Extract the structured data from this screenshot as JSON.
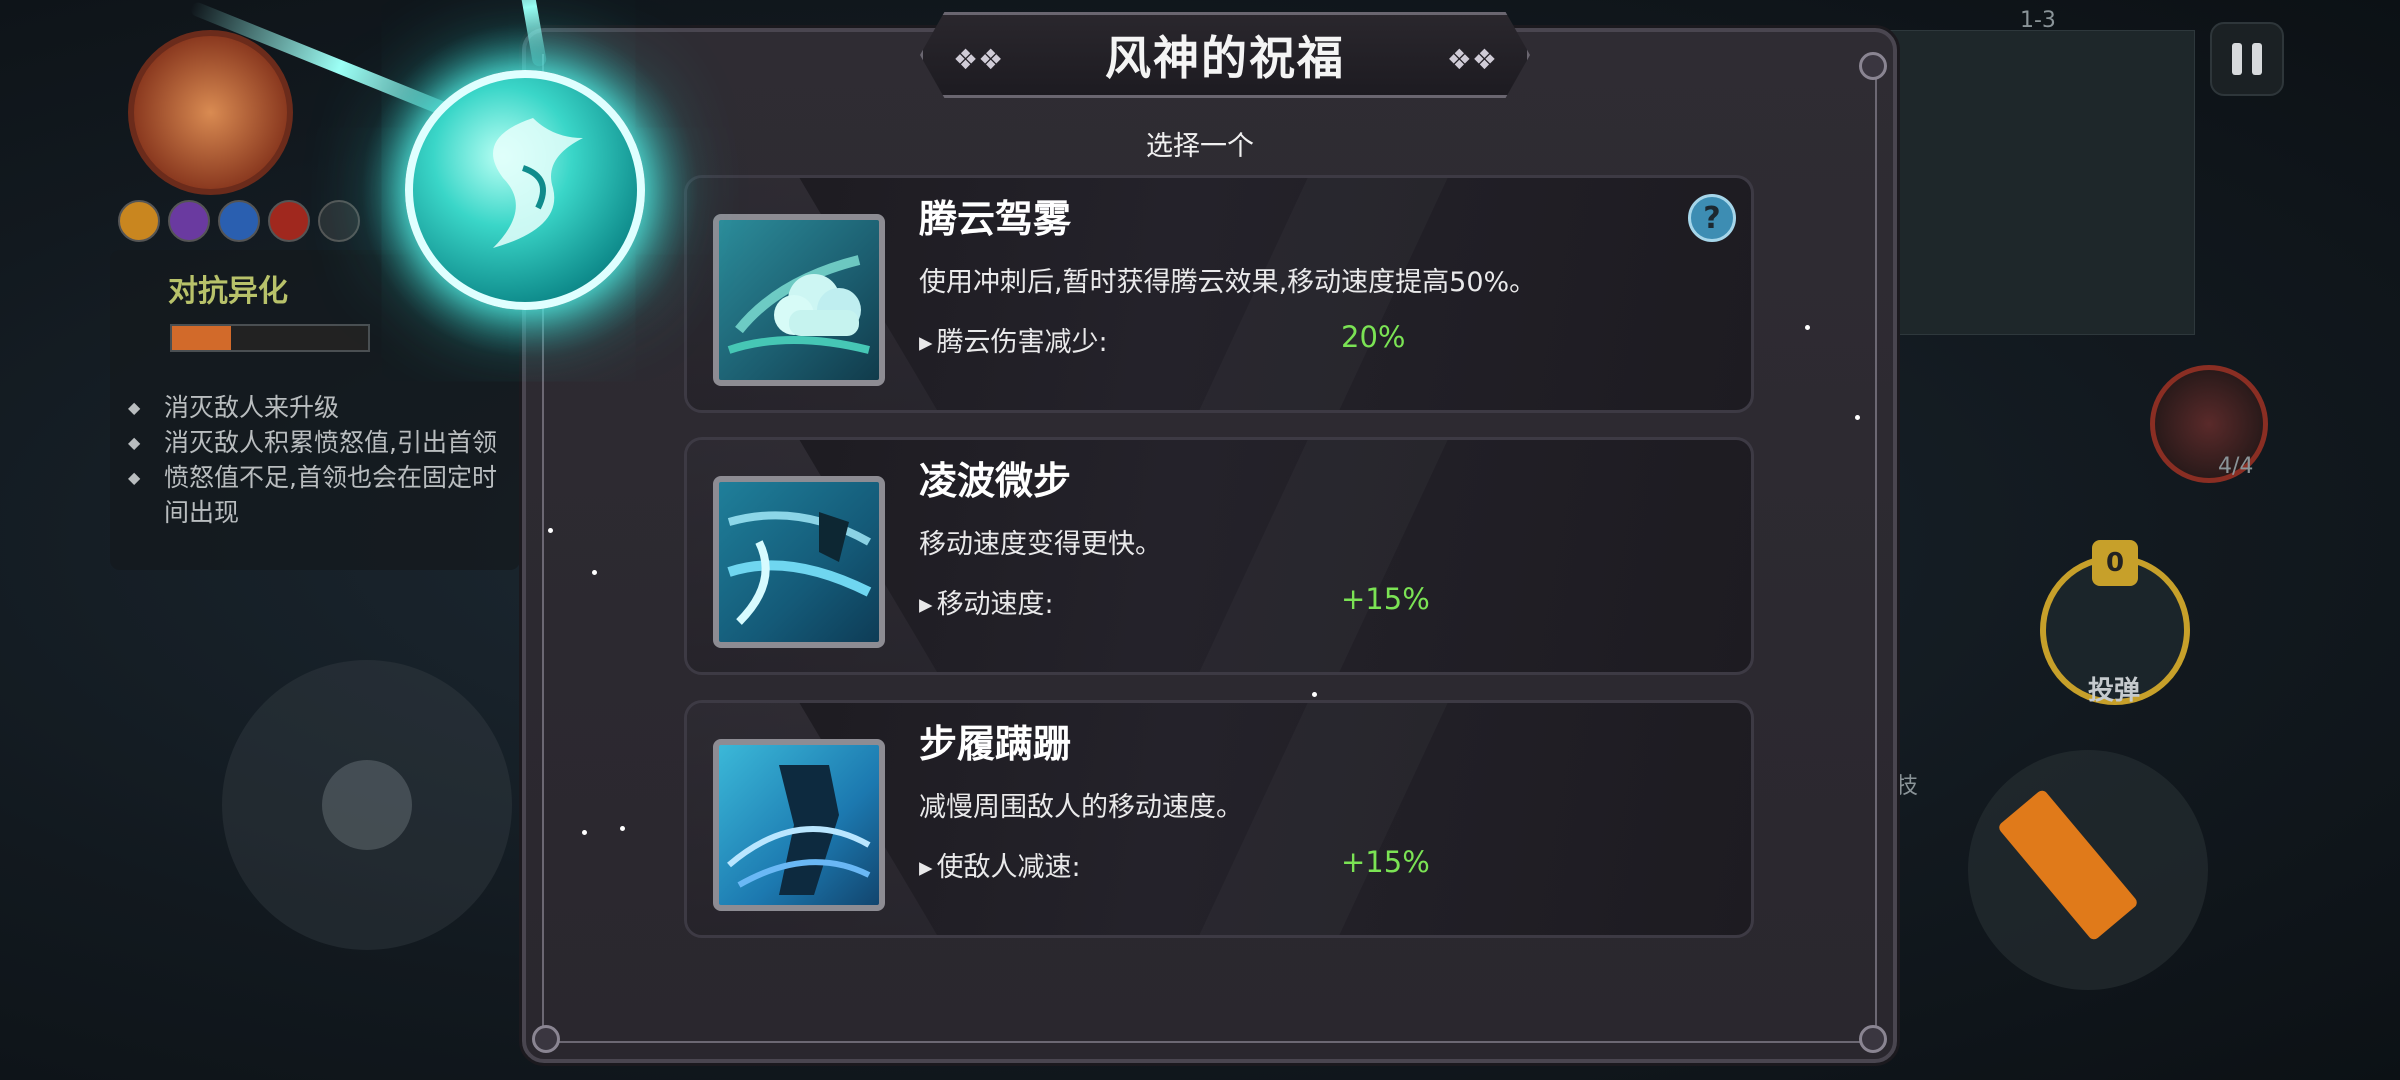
{
  "hud": {
    "level": "1-3",
    "left_panel": {
      "title": "对抗异化",
      "progress": 0.3,
      "bullets": [
        "消灭敌人来升级",
        "消灭敌人积累愤怒值,引出首领",
        "愤怒值不足,首领也会在固定时间出现"
      ]
    },
    "potion_count": "4/4",
    "bomb_count": "0",
    "bomb_label": "投弹",
    "skill_label": "技"
  },
  "modal": {
    "title": "风神的祝福",
    "subtitle": "选择一个",
    "cards": [
      {
        "title": "腾云驾雾",
        "description": "使用冲刺后,暂时获得腾云效果,移动速度提高50%。",
        "stat_label": "腾云伤害减少:",
        "stat_value": "20%",
        "icon": "cloud-icon",
        "has_help": true
      },
      {
        "title": "凌波微步",
        "description": "移动速度变得更快。",
        "stat_label": "移动速度:",
        "stat_value": "+15%",
        "icon": "wind-step-icon",
        "has_help": false
      },
      {
        "title": "步履蹒跚",
        "description": "减慢周围敌人的移动速度。",
        "stat_label": "使敌人减速:",
        "stat_value": "+15%",
        "icon": "slow-enemy-icon",
        "has_help": false
      }
    ],
    "help_glyph": "?"
  },
  "colors": {
    "stat_green": "#7be354",
    "orb_cyan": "#3ad6c8",
    "help_blue": "#3d8db3"
  }
}
